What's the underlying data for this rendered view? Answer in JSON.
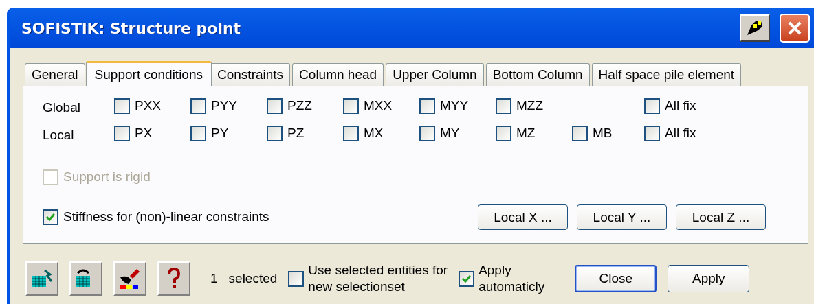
{
  "window": {
    "title": "SOFiSTiK: Structure point"
  },
  "tabs": [
    {
      "label": "General",
      "selected": false
    },
    {
      "label": "Support conditions",
      "selected": true
    },
    {
      "label": "Constraints",
      "selected": false
    },
    {
      "label": "Column head",
      "selected": false
    },
    {
      "label": "Upper Column",
      "selected": false
    },
    {
      "label": "Bottom Column",
      "selected": false
    },
    {
      "label": "Half space pile element",
      "selected": false
    }
  ],
  "support_rows": [
    {
      "label": "Global",
      "items": [
        {
          "label": "PXX",
          "checked": false
        },
        {
          "label": "PYY",
          "checked": false
        },
        {
          "label": "PZZ",
          "checked": false
        },
        {
          "label": "MXX",
          "checked": false
        },
        {
          "label": "MYY",
          "checked": false
        },
        {
          "label": "MZZ",
          "checked": false
        }
      ],
      "all_fix": {
        "label": "All fix",
        "checked": false
      }
    },
    {
      "label": "Local",
      "items": [
        {
          "label": "PX",
          "checked": false
        },
        {
          "label": "PY",
          "checked": false
        },
        {
          "label": "PZ",
          "checked": false
        },
        {
          "label": "MX",
          "checked": false
        },
        {
          "label": "MY",
          "checked": false
        },
        {
          "label": "MZ",
          "checked": false
        },
        {
          "label": "MB",
          "checked": false
        }
      ],
      "all_fix": {
        "label": "All fix",
        "checked": false
      }
    }
  ],
  "rigid": {
    "label": "Support is rigid",
    "checked": false,
    "disabled": true
  },
  "stiffness": {
    "label": "Stiffness for (non)-linear constraints",
    "checked": true
  },
  "local_buttons": [
    "Local X ...",
    "Local Y ...",
    "Local Z ..."
  ],
  "footer": {
    "count": "1",
    "count_label": "selected",
    "use_selected": {
      "label_lines": [
        "Use selected entities for",
        "new selectionset"
      ],
      "checked": false
    },
    "apply_auto": {
      "label_lines": [
        "Apply",
        "automaticly"
      ],
      "checked": true
    },
    "buttons": [
      {
        "label": "Close",
        "default": true
      },
      {
        "label": "Apply",
        "default": false
      }
    ]
  }
}
